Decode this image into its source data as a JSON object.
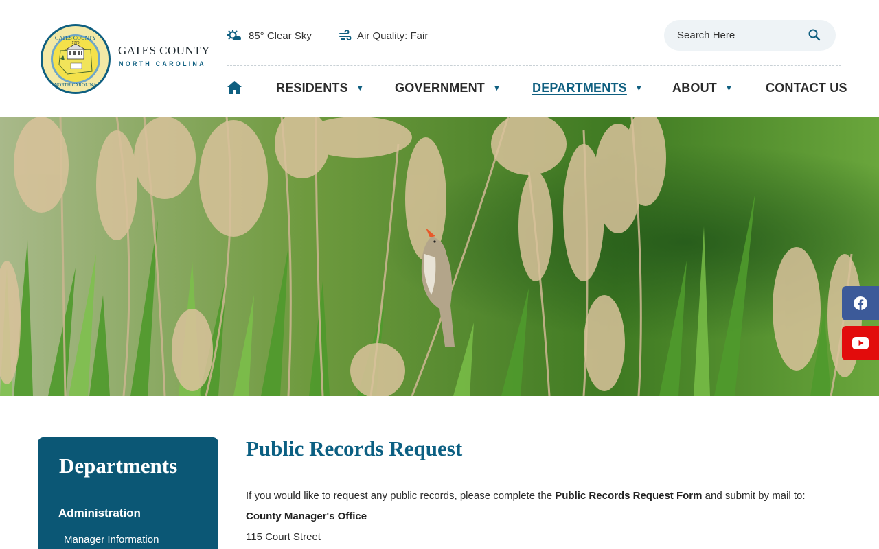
{
  "brand": {
    "name": "GATES COUNTY",
    "subtitle": "NORTH CAROLINA",
    "seal_top": "GATES COUNTY",
    "seal_year": "1779",
    "seal_bottom": "NORTH CAROLINA"
  },
  "weather": {
    "text": "85° Clear Sky",
    "icon": "sun-cloud-icon"
  },
  "air_quality": {
    "text": "Air Quality: Fair",
    "icon": "wind-icon"
  },
  "search": {
    "placeholder": "Search Here",
    "icon": "search-icon"
  },
  "nav": {
    "home_icon": "home-icon",
    "items": [
      {
        "label": "RESIDENTS",
        "has_dropdown": true,
        "active": false
      },
      {
        "label": "GOVERNMENT",
        "has_dropdown": true,
        "active": false
      },
      {
        "label": "DEPARTMENTS",
        "has_dropdown": true,
        "active": true
      },
      {
        "label": "ABOUT",
        "has_dropdown": true,
        "active": false
      },
      {
        "label": "CONTACT US",
        "has_dropdown": false,
        "active": false
      }
    ],
    "caret": "▼"
  },
  "social": [
    {
      "name": "facebook",
      "icon": "facebook-icon",
      "color": "#3c5a99"
    },
    {
      "name": "youtube",
      "icon": "youtube-icon",
      "color": "#e20c0c"
    }
  ],
  "sidebar": {
    "title": "Departments",
    "section": "Administration",
    "items": [
      "Manager Information"
    ]
  },
  "content": {
    "title": "Public Records Request",
    "intro_before": "If you would like to request any public records, please complete the ",
    "intro_link": "Public Records Request Form",
    "intro_after": " and submit by mail to:",
    "office": "County Manager's Office",
    "street": "115 Court Street"
  },
  "colors": {
    "primary": "#0b5775",
    "accent": "#0f5f80",
    "search_bg": "#eef3f6"
  }
}
